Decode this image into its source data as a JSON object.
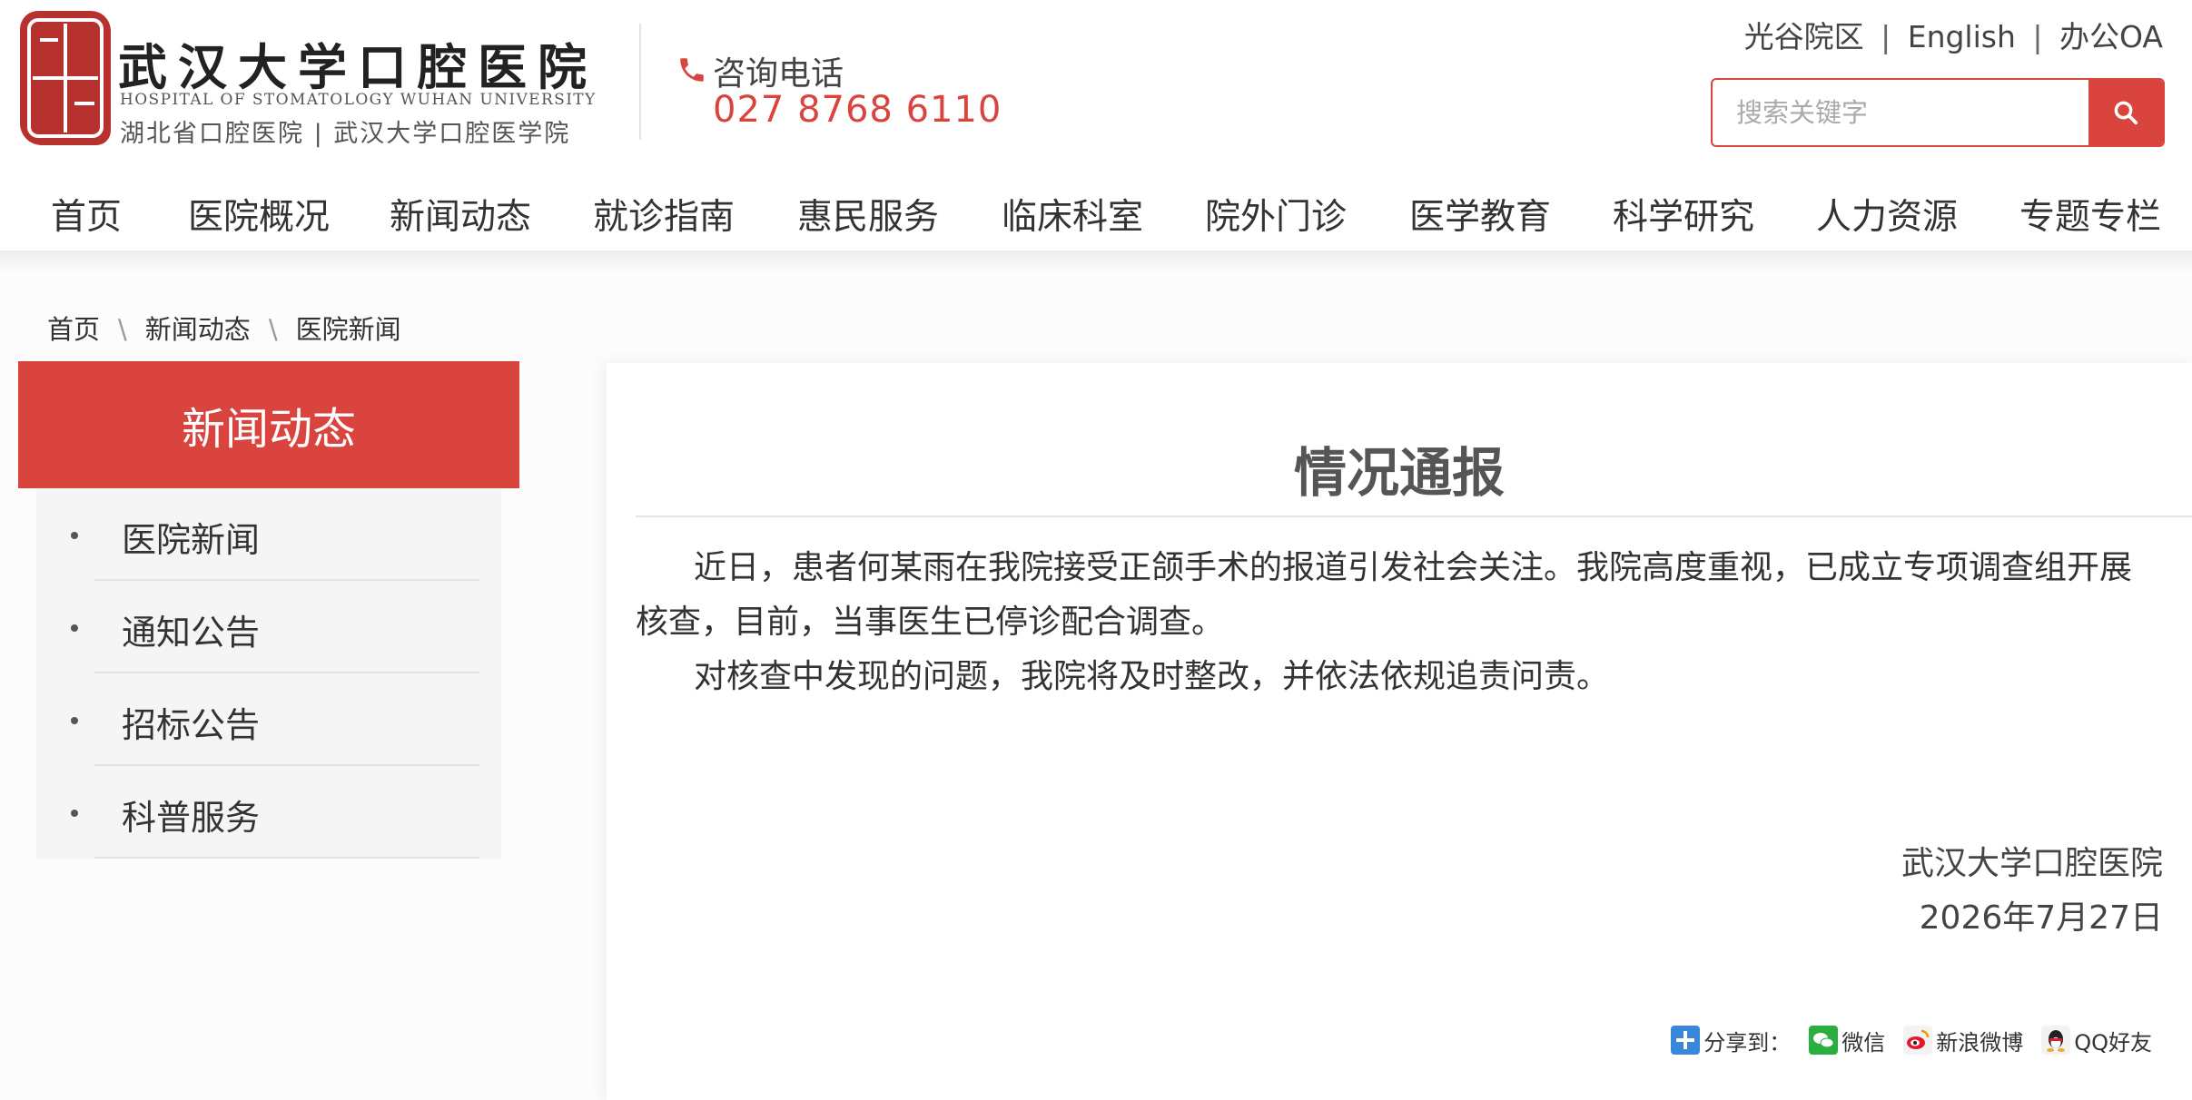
{
  "header": {
    "logo_title": "武汉大学口腔医院",
    "logo_en": "HOSPITAL OF STOMATOLOGY WUHAN UNIVERSITY",
    "logo_sub": "湖北省口腔医院 | 武汉大学口腔医学院",
    "phone_label": "咨询电话",
    "phone_number": "027 8768 6110",
    "links": [
      "光谷院区",
      "English",
      "办公OA"
    ],
    "link_separator": "|",
    "search_placeholder": "搜索关键字"
  },
  "nav": {
    "items": [
      "首页",
      "医院概况",
      "新闻动态",
      "就诊指南",
      "惠民服务",
      "临床科室",
      "院外门诊",
      "医学教育",
      "科学研究",
      "人力资源",
      "专题专栏"
    ]
  },
  "breadcrumb": {
    "items": [
      "首页",
      "新闻动态",
      "医院新闻"
    ],
    "separator": "\\"
  },
  "sidebar": {
    "title": "新闻动态",
    "items": [
      "医院新闻",
      "通知公告",
      "招标公告",
      "科普服务"
    ]
  },
  "article": {
    "title": "情况通报",
    "paragraphs": [
      "近日，患者何某雨在我院接受正颌手术的报道引发社会关注。我院高度重视，已成立专项调查组开展核查，目前，当事医生已停诊配合调查。",
      "对核查中发现的问题，我院将及时整改，并依法依规追责问责。"
    ],
    "signature_org": "武汉大学口腔医院",
    "signature_date": "2026年7月27日"
  },
  "share": {
    "label": "分享到：",
    "wechat": "微信",
    "weibo": "新浪微博",
    "qq": "QQ好友"
  },
  "colors": {
    "accent": "#d9443f",
    "seal": "#b7312f"
  }
}
